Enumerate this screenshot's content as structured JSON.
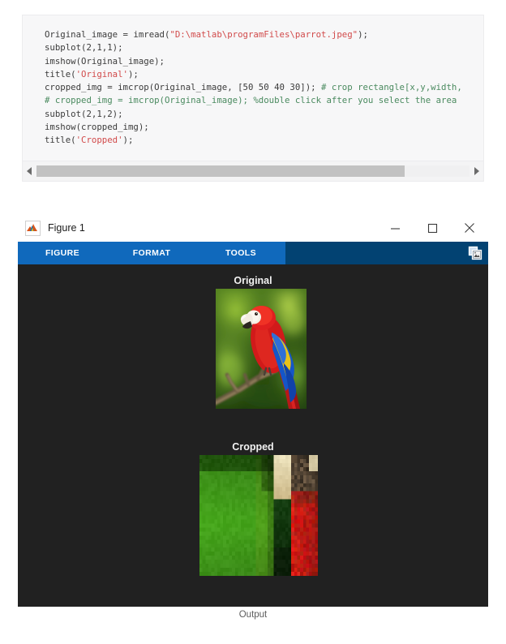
{
  "code_block": {
    "language": "matlab",
    "lines": [
      [
        {
          "t": "plain",
          "s": "Original_image = imread("
        },
        {
          "t": "string",
          "s": "\"D:\\matlab\\programFiles\\parrot.jpeg\""
        },
        {
          "t": "plain",
          "s": ");"
        }
      ],
      [
        {
          "t": "plain",
          "s": "subplot(2,1,1);"
        }
      ],
      [
        {
          "t": "plain",
          "s": "imshow(Original_image);"
        }
      ],
      [
        {
          "t": "plain",
          "s": "title("
        },
        {
          "t": "string",
          "s": "'Original'"
        },
        {
          "t": "plain",
          "s": ");"
        }
      ],
      [
        {
          "t": "plain",
          "s": "cropped_img = imcrop(Original_image, [50 50 40 30]); "
        },
        {
          "t": "comment",
          "s": "# crop rectangle[x,y,width,"
        }
      ],
      [
        {
          "t": "comment",
          "s": "# cropped_img = imcrop(Original_image); %double click after you select the area"
        }
      ],
      [
        {
          "t": "plain",
          "s": "subplot(2,1,2);"
        }
      ],
      [
        {
          "t": "plain",
          "s": "imshow(cropped_img);"
        }
      ],
      [
        {
          "t": "plain",
          "s": "title("
        },
        {
          "t": "string",
          "s": "'Cropped'"
        },
        {
          "t": "plain",
          "s": ");"
        }
      ]
    ],
    "scrollbar": {
      "left_arrow": "left-arrow",
      "right_arrow": "right-arrow",
      "thumb_width_percent": 85
    },
    "colors": {
      "background": "#f7f7f8",
      "text": "#3b3b3b",
      "string": "#d14a4a",
      "comment": "#4a8a5f"
    }
  },
  "figure_window": {
    "title": "Figure 1",
    "app_icon": "matlab-membrane-icon",
    "window_controls": [
      {
        "name": "minimize",
        "glyph": "minimize-icon"
      },
      {
        "name": "maximize",
        "glyph": "maximize-icon"
      },
      {
        "name": "close",
        "glyph": "close-icon"
      }
    ],
    "toolbar": {
      "tabs": [
        "FIGURE",
        "FORMAT",
        "TOOLS"
      ],
      "copy_button": "copy-figure-icon",
      "tab_bg": "#1069bc",
      "bar_bg": "#024272"
    },
    "canvas": {
      "background": "#212121",
      "subplots": [
        {
          "title": "Original",
          "image_alt": "scarlet-macaw-parrot-on-branch"
        },
        {
          "title": "Cropped",
          "image_alt": "pixelated-crop-of-parrot-head-and-body"
        }
      ]
    }
  },
  "caption": "Output"
}
